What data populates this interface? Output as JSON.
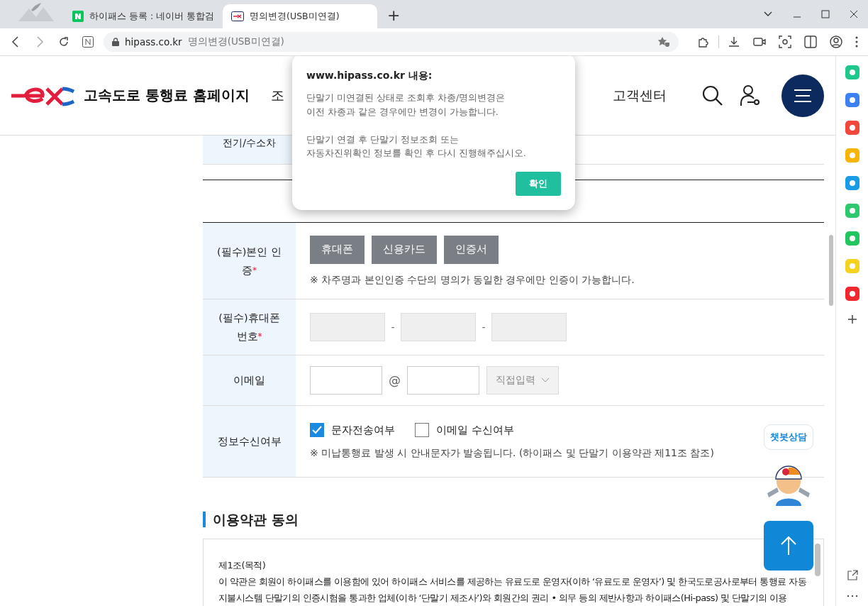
{
  "browser": {
    "tabs": [
      {
        "label": "하이패스 등록 : 네이버 통합검",
        "selected": false
      },
      {
        "label": "명의변경(USB미연결)",
        "selected": true
      }
    ],
    "new_tab": "+",
    "address": {
      "domain": "hipass.co.kr",
      "title": "명의변경(USB미연결)"
    }
  },
  "site": {
    "title": "고속도로 통행료 홈페이지",
    "nav": [
      "조",
      "고객센터"
    ]
  },
  "partial_row": {
    "label": "전기/수소차"
  },
  "form": {
    "rows": [
      {
        "kind": "buttons",
        "label": "(필수)본인 인증",
        "mark": "*",
        "buttons": [
          "휴대폰",
          "신용카드",
          "인증서"
        ],
        "note": "※ 차주명과 본인인증 수단의 명의가 동일한 경우에만 인증이 가능합니다."
      },
      {
        "kind": "phone",
        "label": "(필수)휴대폰번호",
        "mark": "*",
        "separator": "-"
      },
      {
        "kind": "email",
        "label": "이메일",
        "at": "@",
        "select": "직접입력"
      },
      {
        "kind": "checks",
        "label": "정보수신여부",
        "checks": [
          {
            "label": "문자전송여부",
            "checked": true
          },
          {
            "label": "이메일 수신여부",
            "checked": false
          }
        ],
        "note": "※ 미납통행료 발생 시 안내문자가 발송됩니다. (하이패스 및 단말기 이용약관 제11조 참조)"
      }
    ]
  },
  "terms": {
    "heading": "이용약관 동의",
    "article": "제1조(목적)",
    "text": "이 약관은 회원이 하이패스를 이용함에 있어 하이패스 서비스를 제공하는 유료도로 운영자(이하 ‘유료도로 운영자’) 및 한국도로공사로부터 통행료 자동지불시스템 단말기의 인증시험을 통과한 업체(이하 ‘단말기 제조사’)와 회원간의 권리 • 의무 등의 제반사항과 하이패스(Hi-pass) 및 단말기의 이용"
  },
  "chatbot": {
    "label": "챗봇상담"
  },
  "dialog": {
    "title": "www.hipass.co.kr 내용:",
    "paragraphs": [
      [
        "단말기 미연결된 상태로 조회후 차종/명의변경은",
        "이전 차종과 같은 경우에만 변경이 가능합니다."
      ],
      [
        "단말기 연결 후 단말기 정보조회 또는",
        "자동차진위확인 정보를 확인 후 다시 진행해주십시오."
      ]
    ],
    "button": "확인"
  }
}
